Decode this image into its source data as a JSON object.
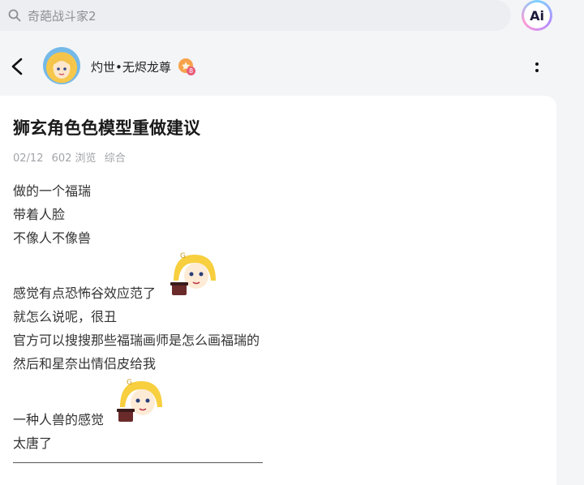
{
  "search": {
    "text": "奇葩战斗家2"
  },
  "ai_button": {
    "label": "Ai"
  },
  "author": {
    "name": "灼世•无烬龙尊",
    "badge_level": "8"
  },
  "post": {
    "title": "狮玄角色色模型重做建议",
    "date": "02/12",
    "views": "602 浏览",
    "category": "综合",
    "lines": [
      "做的一个福瑞",
      "带着人脸",
      "不像人不像兽",
      "感觉有点恐怖谷效应范了",
      "就怎么说呢，很丑",
      "官方可以搜搜那些福瑞画师是怎么画福瑞的",
      "然后和星奈出情侣皮给我",
      "一种人兽的感觉",
      "太唐了"
    ]
  },
  "colors": {
    "background": "#f4f5f7",
    "card": "#ffffff",
    "meta_text": "#a2a4a8",
    "search_bg": "#eceef1"
  },
  "icons": [
    "search-icon",
    "ai-icon",
    "back-arrow-icon",
    "more-vertical-icon",
    "level-badge-icon",
    "sticker-emoji"
  ]
}
